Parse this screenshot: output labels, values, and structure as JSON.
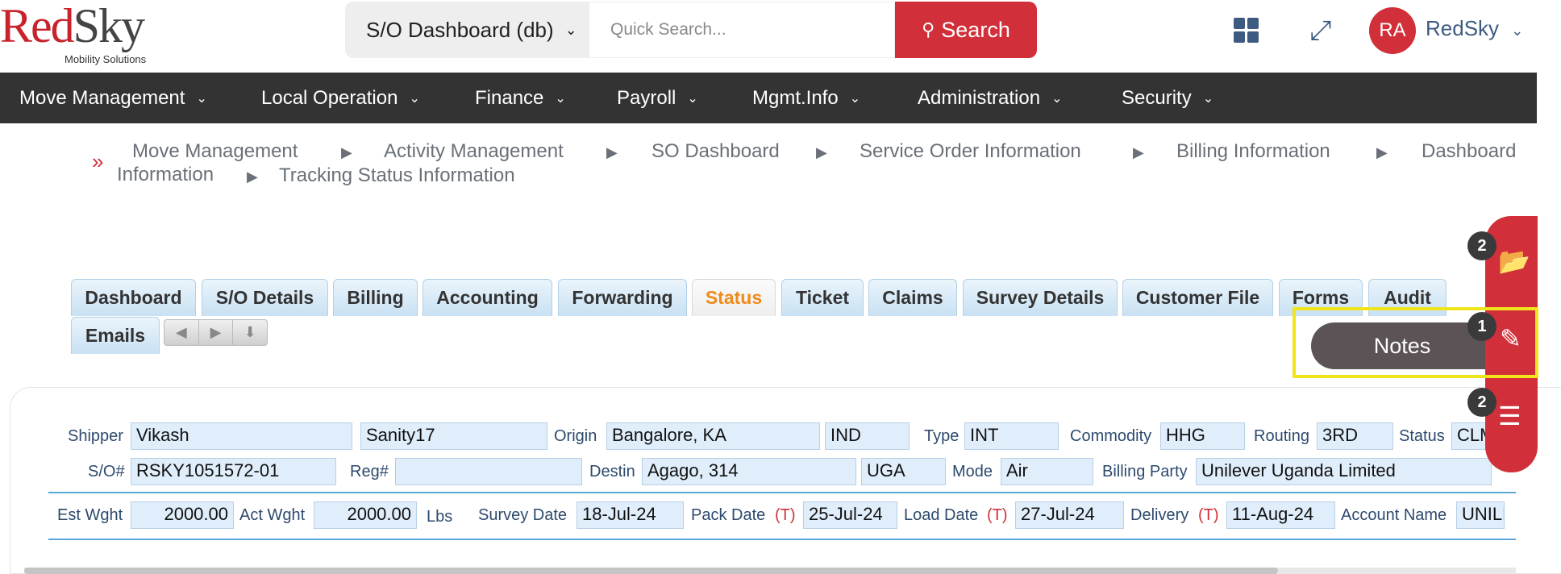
{
  "header": {
    "logo_main_red": "Red",
    "logo_main_dark": "Sky",
    "logo_sub": "Mobility Solutions",
    "dashboard_select": "S/O Dashboard (db)",
    "search_placeholder": "Quick Search...",
    "search_button": "Search",
    "avatar_initials": "RA",
    "user_name": "RedSky"
  },
  "nav": {
    "items": [
      "Move Management",
      "Local Operation",
      "Finance",
      "Payroll",
      "Mgmt.Info",
      "Administration",
      "Security"
    ]
  },
  "breadcrumb": {
    "items": [
      "Move Management",
      "Activity Management",
      "SO Dashboard",
      "Service Order Information",
      "Billing Information",
      "Dashboard",
      "Information",
      "Tracking Status Information"
    ]
  },
  "tabs": {
    "items": [
      "Dashboard",
      "S/O Details",
      "Billing",
      "Accounting",
      "Forwarding",
      "Status",
      "Ticket",
      "Claims",
      "Survey Details",
      "Customer File",
      "Forms",
      "Audit",
      "Emails"
    ],
    "active": "Status"
  },
  "form": {
    "row1": {
      "shipper_label": "Shipper",
      "shipper_first": "Vikash",
      "shipper_last": "Sanity17",
      "origin_label": "Origin",
      "origin_city": "Bangalore, KA",
      "origin_country": "IND",
      "type_label": "Type",
      "type_value": "INT",
      "commodity_label": "Commodity",
      "commodity_value": "HHG",
      "routing_label": "Routing",
      "routing_value": "3RD",
      "status_label": "Status",
      "status_value": "CLMS"
    },
    "row2": {
      "so_label": "S/O#",
      "so_value": "RSKY1051572-01",
      "reg_label": "Reg#",
      "reg_value": "",
      "destin_label": "Destin",
      "destin_city": "Agago, 314",
      "destin_country": "UGA",
      "mode_label": "Mode",
      "mode_value": "Air",
      "billing_party_label": "Billing Party",
      "billing_party_value": "Unilever Uganda Limited"
    },
    "row3": {
      "est_wght_label": "Est Wght",
      "est_wght_value": "2000.00",
      "act_wght_label": "Act Wght",
      "act_wght_value": "2000.00",
      "unit": "Lbs",
      "survey_date_label": "Survey Date",
      "survey_date_value": "18-Jul-24",
      "pack_date_label": "Pack Date",
      "pack_date_t": "(T)",
      "pack_date_value": "25-Jul-24",
      "load_date_label": "Load Date",
      "load_date_t": "(T)",
      "load_date_value": "27-Jul-24",
      "delivery_label": "Delivery",
      "delivery_t": "(T)",
      "delivery_value": "11-Aug-24",
      "account_name_label": "Account Name",
      "account_name_value": "UNILEVER"
    }
  },
  "float_menu": {
    "files_badge": "2",
    "notes_badge": "1",
    "notes_label": "Notes",
    "tasks_badge": "2"
  },
  "colors": {
    "brand_red": "#d1303a",
    "nav_bg": "#333333",
    "active_tab": "#f08a1a",
    "field_bg": "#e0eefb",
    "highlight": "#f0e41c"
  }
}
